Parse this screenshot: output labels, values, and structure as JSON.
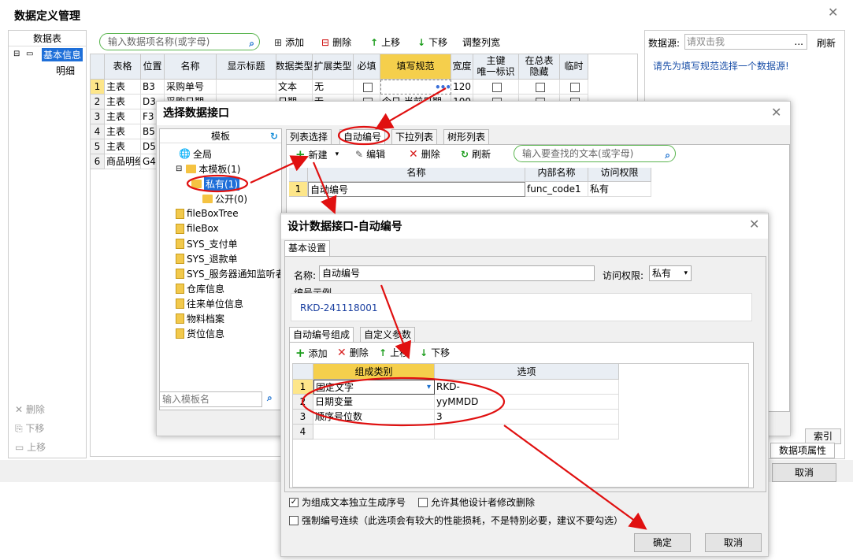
{
  "main": {
    "title": "数据定义管理",
    "left_header": "数据表",
    "tree": [
      "基本信息",
      "明细"
    ],
    "bottom_left": [
      "删除",
      "下移",
      "上移"
    ],
    "search_placeholder": "输入数据项名称(或字母)",
    "toolbar": [
      "添加",
      "删除",
      "上移",
      "下移",
      "调整列宽"
    ],
    "columns": [
      "表格",
      "位置",
      "名称",
      "显示标题",
      "数据类型",
      "扩展类型",
      "必填",
      "填写规范",
      "宽度",
      "主键\n唯一标识",
      "在总表\n隐藏",
      "临时"
    ],
    "rows": [
      {
        "n": "1",
        "table": "主表",
        "pos": "B3",
        "name": "采购单号",
        "type": "文本",
        "ext": "无",
        "width": "120"
      },
      {
        "n": "2",
        "table": "主表",
        "pos": "D3",
        "name": "采购日期",
        "type": "日期",
        "ext": "无",
        "width": "100",
        "rule": "今日 当前日期"
      },
      {
        "n": "3",
        "table": "主表",
        "pos": "F3",
        "name": "",
        "type": "",
        "ext": "",
        "width": ""
      },
      {
        "n": "4",
        "table": "主表",
        "pos": "B5",
        "name": "",
        "type": "",
        "ext": "",
        "width": ""
      },
      {
        "n": "5",
        "table": "主表",
        "pos": "D5",
        "name": "",
        "type": "",
        "ext": "",
        "width": ""
      },
      {
        "n": "6",
        "table": "商品明细",
        "pos": "G4",
        "name": "",
        "type": "",
        "ext": "",
        "width": ""
      }
    ],
    "datasource_label": "数据源:",
    "datasource_placeholder": "请双击我",
    "refresh": "刷新",
    "hint": "请先为填写规范选择一个数据源!",
    "right_tabs": [
      "索引",
      "数据项属性"
    ],
    "cancel": "取消"
  },
  "d1": {
    "title": "选择数据接口",
    "tree_header": "模板",
    "tree": [
      "全局",
      "本模板(1)",
      "私有(1)",
      "公开(0)",
      "fileBoxTree",
      "fileBox",
      "SYS_支付单",
      "SYS_退款单",
      "SYS_服务器通知监听者",
      "仓库信息",
      "往来单位信息",
      "物料档案",
      "货位信息"
    ],
    "tree_search_placeholder": "输入模板名",
    "tabs": [
      "列表选择",
      "自动编号",
      "下拉列表",
      "树形列表"
    ],
    "toolbar": [
      "新建",
      "编辑",
      "删除",
      "刷新"
    ],
    "search_placeholder": "输入要查找的文本(或字母)",
    "columns": [
      "名称",
      "内部名称",
      "访问权限"
    ],
    "rows": [
      {
        "n": "1",
        "name": "自动编号",
        "inner": "func_code1",
        "access": "私有"
      }
    ]
  },
  "d2": {
    "title": "设计数据接口-自动编号",
    "tab": "基本设置",
    "name_label": "名称:",
    "name_value": "自动编号",
    "access_label": "访问权限:",
    "access_value": "私有",
    "example_label": "编号示例",
    "example_value": "RKD-241118001",
    "tabs": [
      "自动编号组成",
      "自定义参数"
    ],
    "toolbar": [
      "添加",
      "删除",
      "上移",
      "下移"
    ],
    "columns": [
      "组成类别",
      "选项"
    ],
    "rows": [
      {
        "n": "1",
        "cat": "固定文字",
        "opt": "RKD-"
      },
      {
        "n": "2",
        "cat": "日期变量",
        "opt": "yyMMDD"
      },
      {
        "n": "3",
        "cat": "顺序号位数",
        "opt": "3"
      },
      {
        "n": "4",
        "cat": "",
        "opt": ""
      }
    ],
    "check1": "为组成文本独立生成序号",
    "check2": "允许其他设计者修改删除",
    "check3": "强制编号连续（此选项会有较大的性能损耗，不是特别必要，建议不要勾选）",
    "ok": "确定",
    "cancel": "取消"
  }
}
